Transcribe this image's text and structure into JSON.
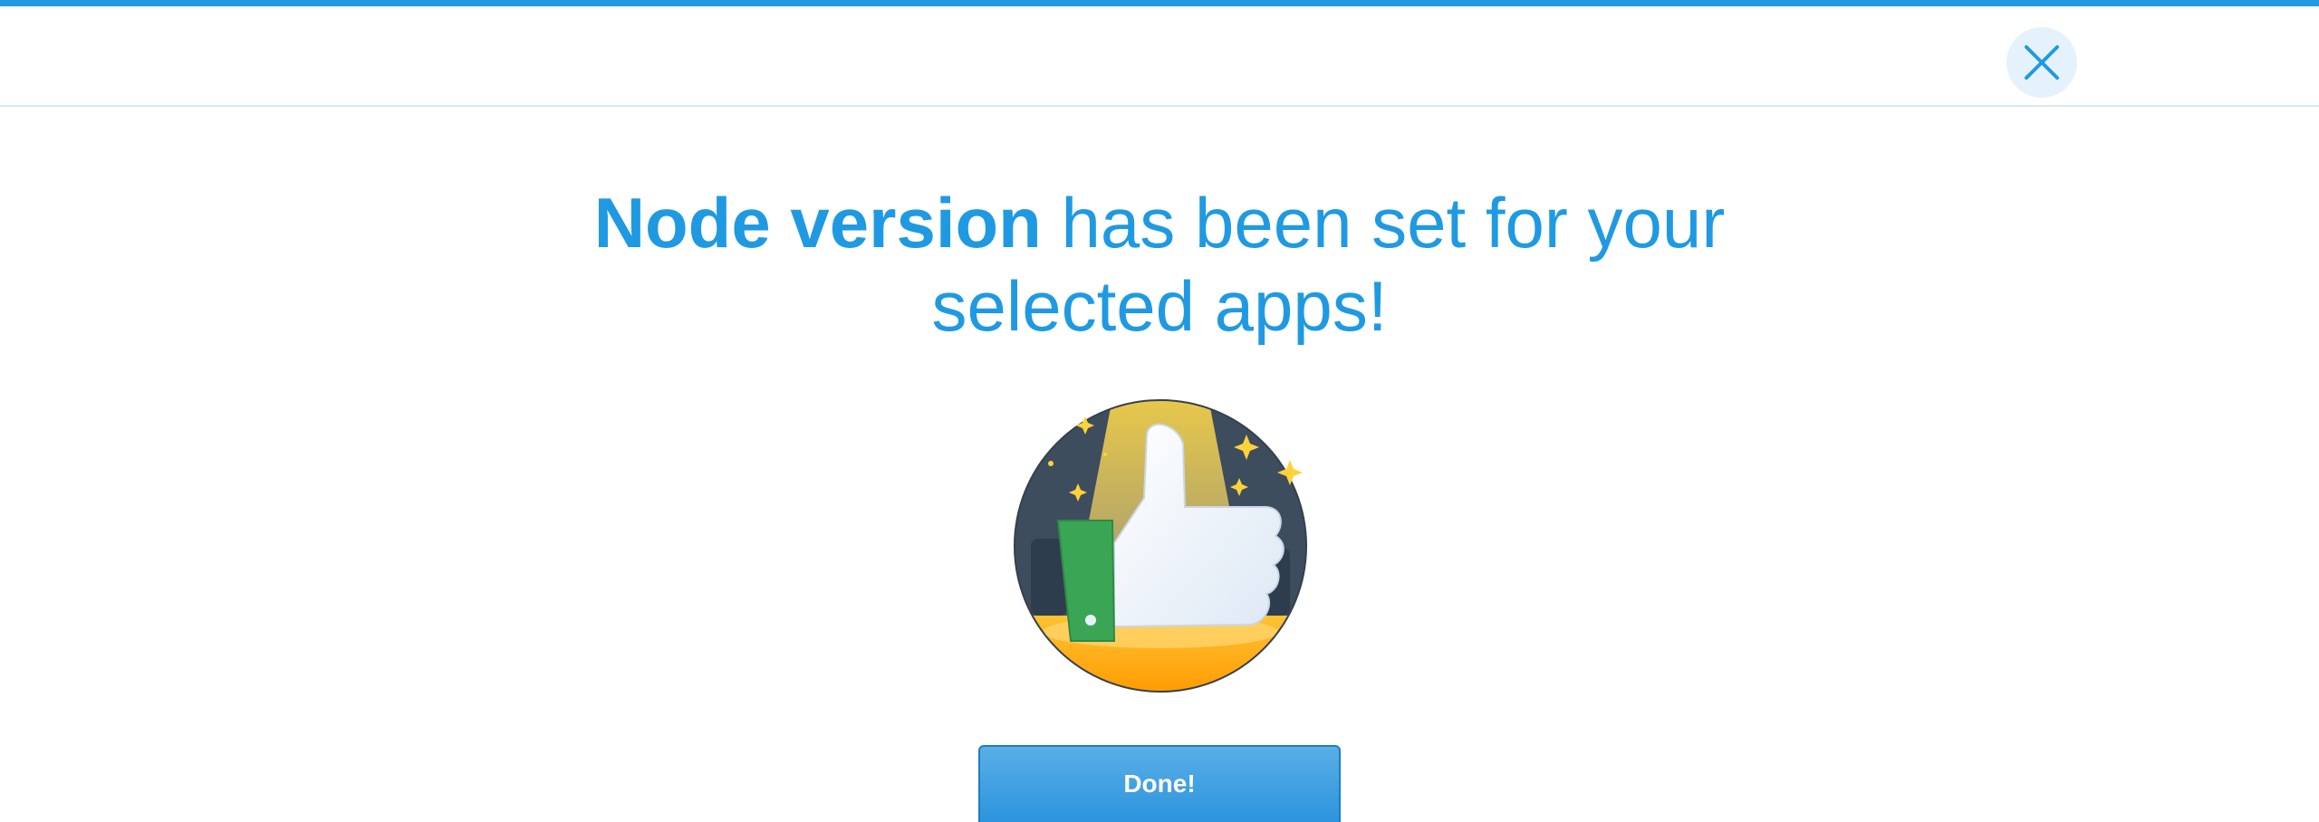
{
  "modal": {
    "close_icon": "close-icon",
    "headline_strong": "Node version",
    "headline_line1_rest": " has been set for your",
    "headline_line2": "selected apps!",
    "illustration_icon": "thumbs-up-icon",
    "done_label": "Done!"
  },
  "colors": {
    "accent": "#1f9ae2",
    "button_top": "#5aaee6",
    "button_bottom": "#2590dc"
  }
}
